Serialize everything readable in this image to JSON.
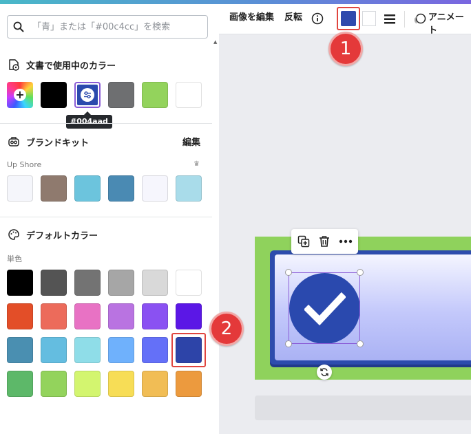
{
  "search": {
    "placeholder": "「青」または「#00c4cc」を検索"
  },
  "doc_colors": {
    "title": "文書で使用中のカラー",
    "swatches": [
      {
        "name": "add-color",
        "color": "rainbow"
      },
      {
        "name": "black",
        "color": "#000000"
      },
      {
        "name": "selected-blue",
        "color": "#2b4aad"
      },
      {
        "name": "gray",
        "color": "#6e6f71"
      },
      {
        "name": "light-green",
        "color": "#93d35c"
      },
      {
        "name": "white",
        "color": "#ffffff"
      }
    ],
    "tooltip": "#004aad"
  },
  "brand_kit": {
    "title": "ブランドキット",
    "edit_label": "編集",
    "palette_name": "Up Shore",
    "swatches": [
      "#f5f6fb",
      "#8f7a6e",
      "#6cc4dd",
      "#4a8ab3",
      "#f6f6fd",
      "#a9dcea"
    ]
  },
  "default_colors": {
    "title": "デフォルトカラー",
    "subtitle": "単色",
    "rows": [
      [
        "#000000",
        "#545454",
        "#737373",
        "#a6a6a6",
        "#d9d9d9",
        "#ffffff"
      ],
      [
        "#e34e28",
        "#ec6b5b",
        "#e872c4",
        "#b973e1",
        "#8a51f2",
        "#5b17e6"
      ],
      [
        "#4a8fb1",
        "#64bde0",
        "#8fdde8",
        "#6fb1fc",
        "#6470f8",
        "#2d44a8"
      ],
      [
        "#5db869",
        "#93d35c",
        "#d3f56f",
        "#f7dd56",
        "#f1bd55",
        "#ec9a3e"
      ]
    ]
  },
  "toolbar": {
    "edit_image": "画像を編集",
    "flip": "反転",
    "animate": "アニメート",
    "current_color": "#2f4aad"
  },
  "annotations": {
    "badge1": "1",
    "badge2": "2"
  }
}
